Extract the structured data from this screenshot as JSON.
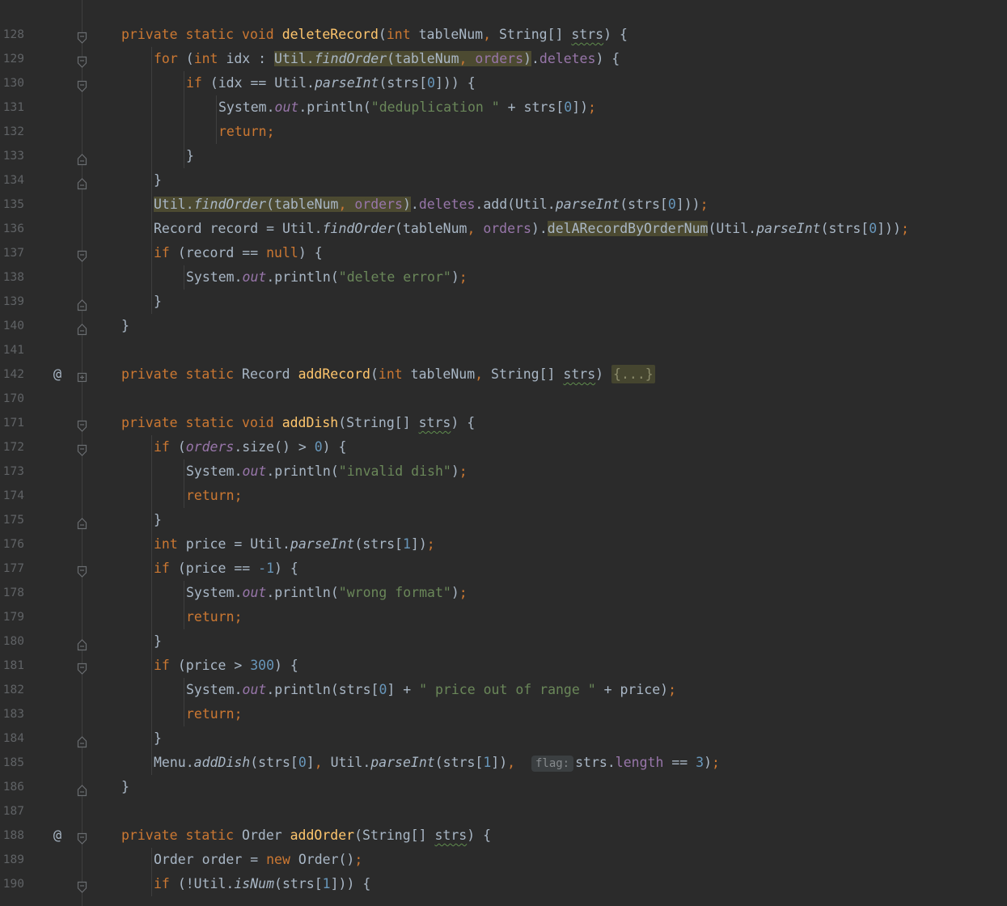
{
  "editor": {
    "lines": [
      {
        "num": "128",
        "mark": "",
        "fold": "open",
        "indent": 1,
        "tokens": [
          [
            "k",
            "private static void "
          ],
          [
            "m",
            "deleteRecord"
          ],
          [
            "p",
            "("
          ],
          [
            "k",
            "int "
          ],
          [
            "p",
            "tableNum"
          ],
          [
            "k",
            ", "
          ],
          [
            "p",
            "String[] "
          ],
          [
            "pw",
            "strs"
          ],
          [
            "p",
            ") {"
          ]
        ]
      },
      {
        "num": "129",
        "mark": "",
        "fold": "open",
        "indent": 2,
        "tokens": [
          [
            "k",
            "for "
          ],
          [
            "p",
            "("
          ],
          [
            "k",
            "int "
          ],
          [
            "p",
            "idx : "
          ],
          [
            "hp",
            "Util."
          ],
          [
            "hi",
            "findOrder"
          ],
          [
            "hp",
            "(tableNum"
          ],
          [
            "hk",
            ", "
          ],
          [
            "hf",
            "orders"
          ],
          [
            "hp",
            ")"
          ],
          [
            "p",
            "."
          ],
          [
            "f",
            "deletes"
          ],
          [
            "p",
            ") {"
          ]
        ]
      },
      {
        "num": "130",
        "mark": "",
        "fold": "open",
        "indent": 3,
        "tokens": [
          [
            "k",
            "if "
          ],
          [
            "p",
            "(idx == Util."
          ],
          [
            "i",
            "parseInt"
          ],
          [
            "p",
            "(strs["
          ],
          [
            "n",
            "0"
          ],
          [
            "p",
            "])) {"
          ]
        ]
      },
      {
        "num": "131",
        "mark": "",
        "fold": "",
        "indent": 4,
        "tokens": [
          [
            "p",
            "System."
          ],
          [
            "fi",
            "out"
          ],
          [
            "p",
            ".println("
          ],
          [
            "s",
            "\"deduplication \""
          ],
          [
            "p",
            " + strs["
          ],
          [
            "n",
            "0"
          ],
          [
            "p",
            "])"
          ],
          [
            "k",
            ";"
          ]
        ]
      },
      {
        "num": "132",
        "mark": "",
        "fold": "",
        "indent": 4,
        "tokens": [
          [
            "k",
            "return;"
          ]
        ]
      },
      {
        "num": "133",
        "mark": "",
        "fold": "close",
        "indent": 3,
        "tokens": [
          [
            "p",
            "}"
          ]
        ]
      },
      {
        "num": "134",
        "mark": "",
        "fold": "close",
        "indent": 2,
        "tokens": [
          [
            "p",
            "}"
          ]
        ]
      },
      {
        "num": "135",
        "mark": "",
        "fold": "",
        "indent": 2,
        "tokens": [
          [
            "hp",
            "Util."
          ],
          [
            "hi",
            "findOrder"
          ],
          [
            "hp",
            "(tableNum"
          ],
          [
            "hk",
            ", "
          ],
          [
            "hf",
            "orders"
          ],
          [
            "hp",
            ")"
          ],
          [
            "p",
            "."
          ],
          [
            "f",
            "deletes"
          ],
          [
            "p",
            ".add(Util."
          ],
          [
            "i",
            "parseInt"
          ],
          [
            "p",
            "(strs["
          ],
          [
            "n",
            "0"
          ],
          [
            "p",
            "]))"
          ],
          [
            "k",
            ";"
          ]
        ]
      },
      {
        "num": "136",
        "mark": "",
        "fold": "",
        "indent": 2,
        "tokens": [
          [
            "p",
            "Record record = Util."
          ],
          [
            "i",
            "findOrder"
          ],
          [
            "p",
            "(tableNum"
          ],
          [
            "k",
            ", "
          ],
          [
            "f",
            "orders"
          ],
          [
            "p",
            ")."
          ],
          [
            "hp",
            "delARecordByOrderNum"
          ],
          [
            "p",
            "(Util."
          ],
          [
            "i",
            "parseInt"
          ],
          [
            "p",
            "(strs["
          ],
          [
            "n",
            "0"
          ],
          [
            "p",
            "]))"
          ],
          [
            "k",
            ";"
          ]
        ]
      },
      {
        "num": "137",
        "mark": "",
        "fold": "open",
        "indent": 2,
        "tokens": [
          [
            "k",
            "if "
          ],
          [
            "p",
            "(record == "
          ],
          [
            "k",
            "null"
          ],
          [
            "p",
            ") {"
          ]
        ]
      },
      {
        "num": "138",
        "mark": "",
        "fold": "",
        "indent": 3,
        "tokens": [
          [
            "p",
            "System."
          ],
          [
            "fi",
            "out"
          ],
          [
            "p",
            ".println("
          ],
          [
            "s",
            "\"delete error\""
          ],
          [
            "p",
            ")"
          ],
          [
            "k",
            ";"
          ]
        ]
      },
      {
        "num": "139",
        "mark": "",
        "fold": "close",
        "indent": 2,
        "tokens": [
          [
            "p",
            "}"
          ]
        ]
      },
      {
        "num": "140",
        "mark": "",
        "fold": "close",
        "indent": 1,
        "tokens": [
          [
            "p",
            "}"
          ]
        ]
      },
      {
        "num": "141",
        "mark": "",
        "fold": "",
        "indent": 1,
        "tokens": []
      },
      {
        "num": "142",
        "mark": "@",
        "fold": "folded",
        "indent": 1,
        "tokens": [
          [
            "k",
            "private static "
          ],
          [
            "p",
            "Record "
          ],
          [
            "m",
            "addRecord"
          ],
          [
            "p",
            "("
          ],
          [
            "k",
            "int "
          ],
          [
            "p",
            "tableNum"
          ],
          [
            "k",
            ", "
          ],
          [
            "p",
            "String[] "
          ],
          [
            "pw",
            "strs"
          ],
          [
            "p",
            ") "
          ],
          [
            "fd",
            "{...}"
          ]
        ]
      },
      {
        "num": "170",
        "mark": "",
        "fold": "",
        "indent": 1,
        "tokens": []
      },
      {
        "num": "171",
        "mark": "",
        "fold": "open",
        "indent": 1,
        "tokens": [
          [
            "k",
            "private static void "
          ],
          [
            "m",
            "addDish"
          ],
          [
            "p",
            "(String[] "
          ],
          [
            "pw",
            "strs"
          ],
          [
            "p",
            ") {"
          ]
        ]
      },
      {
        "num": "172",
        "mark": "",
        "fold": "open",
        "indent": 2,
        "tokens": [
          [
            "k",
            "if "
          ],
          [
            "p",
            "("
          ],
          [
            "fi",
            "orders"
          ],
          [
            "p",
            ".size() > "
          ],
          [
            "n",
            "0"
          ],
          [
            "p",
            ") {"
          ]
        ]
      },
      {
        "num": "173",
        "mark": "",
        "fold": "",
        "indent": 3,
        "tokens": [
          [
            "p",
            "System."
          ],
          [
            "fi",
            "out"
          ],
          [
            "p",
            ".println("
          ],
          [
            "s",
            "\"invalid dish\""
          ],
          [
            "p",
            ")"
          ],
          [
            "k",
            ";"
          ]
        ]
      },
      {
        "num": "174",
        "mark": "",
        "fold": "",
        "indent": 3,
        "tokens": [
          [
            "k",
            "return;"
          ]
        ]
      },
      {
        "num": "175",
        "mark": "",
        "fold": "close",
        "indent": 2,
        "tokens": [
          [
            "p",
            "}"
          ]
        ]
      },
      {
        "num": "176",
        "mark": "",
        "fold": "",
        "indent": 2,
        "tokens": [
          [
            "k",
            "int "
          ],
          [
            "p",
            "price = Util."
          ],
          [
            "i",
            "parseInt"
          ],
          [
            "p",
            "(strs["
          ],
          [
            "n",
            "1"
          ],
          [
            "p",
            "])"
          ],
          [
            "k",
            ";"
          ]
        ]
      },
      {
        "num": "177",
        "mark": "",
        "fold": "open",
        "indent": 2,
        "tokens": [
          [
            "k",
            "if "
          ],
          [
            "p",
            "(price == "
          ],
          [
            "n",
            "-1"
          ],
          [
            "p",
            ") {"
          ]
        ]
      },
      {
        "num": "178",
        "mark": "",
        "fold": "",
        "indent": 3,
        "tokens": [
          [
            "p",
            "System."
          ],
          [
            "fi",
            "out"
          ],
          [
            "p",
            ".println("
          ],
          [
            "s",
            "\"wrong format\""
          ],
          [
            "p",
            ")"
          ],
          [
            "k",
            ";"
          ]
        ]
      },
      {
        "num": "179",
        "mark": "",
        "fold": "",
        "indent": 3,
        "tokens": [
          [
            "k",
            "return;"
          ]
        ]
      },
      {
        "num": "180",
        "mark": "",
        "fold": "close",
        "indent": 2,
        "tokens": [
          [
            "p",
            "}"
          ]
        ]
      },
      {
        "num": "181",
        "mark": "",
        "fold": "open",
        "indent": 2,
        "tokens": [
          [
            "k",
            "if "
          ],
          [
            "p",
            "(price > "
          ],
          [
            "n",
            "300"
          ],
          [
            "p",
            ") {"
          ]
        ]
      },
      {
        "num": "182",
        "mark": "",
        "fold": "",
        "indent": 3,
        "tokens": [
          [
            "p",
            "System."
          ],
          [
            "fi",
            "out"
          ],
          [
            "p",
            ".println(strs["
          ],
          [
            "n",
            "0"
          ],
          [
            "p",
            "] + "
          ],
          [
            "s",
            "\" price out of range \""
          ],
          [
            "p",
            " + price)"
          ],
          [
            "k",
            ";"
          ]
        ]
      },
      {
        "num": "183",
        "mark": "",
        "fold": "",
        "indent": 3,
        "tokens": [
          [
            "k",
            "return;"
          ]
        ]
      },
      {
        "num": "184",
        "mark": "",
        "fold": "close",
        "indent": 2,
        "tokens": [
          [
            "p",
            "}"
          ]
        ]
      },
      {
        "num": "185",
        "mark": "",
        "fold": "",
        "indent": 2,
        "tokens": [
          [
            "p",
            "Menu."
          ],
          [
            "i",
            "addDish"
          ],
          [
            "p",
            "(strs["
          ],
          [
            "n",
            "0"
          ],
          [
            "p",
            "]"
          ],
          [
            "k",
            ", "
          ],
          [
            "p",
            "Util."
          ],
          [
            "i",
            "parseInt"
          ],
          [
            "p",
            "(strs["
          ],
          [
            "n",
            "1"
          ],
          [
            "p",
            "])"
          ],
          [
            "k",
            ",  "
          ],
          [
            "hint",
            "flag:"
          ],
          [
            "p",
            "strs."
          ],
          [
            "f",
            "length"
          ],
          [
            "p",
            " == "
          ],
          [
            "n",
            "3"
          ],
          [
            "p",
            ")"
          ],
          [
            "k",
            ";"
          ]
        ]
      },
      {
        "num": "186",
        "mark": "",
        "fold": "close",
        "indent": 1,
        "tokens": [
          [
            "p",
            "}"
          ]
        ]
      },
      {
        "num": "187",
        "mark": "",
        "fold": "",
        "indent": 1,
        "tokens": []
      },
      {
        "num": "188",
        "mark": "@",
        "fold": "open",
        "indent": 1,
        "tokens": [
          [
            "k",
            "private static "
          ],
          [
            "p",
            "Order "
          ],
          [
            "m",
            "addOrder"
          ],
          [
            "p",
            "(String[] "
          ],
          [
            "pw",
            "strs"
          ],
          [
            "p",
            ") {"
          ]
        ]
      },
      {
        "num": "189",
        "mark": "",
        "fold": "",
        "indent": 2,
        "tokens": [
          [
            "p",
            "Order order = "
          ],
          [
            "k",
            "new "
          ],
          [
            "p",
            "Order()"
          ],
          [
            "k",
            ";"
          ]
        ]
      },
      {
        "num": "190",
        "mark": "",
        "fold": "open",
        "indent": 2,
        "tokens": [
          [
            "k",
            "if "
          ],
          [
            "p",
            "(!Util."
          ],
          [
            "i",
            "isNum"
          ],
          [
            "p",
            "(strs["
          ],
          [
            "n",
            "1"
          ],
          [
            "p",
            "])) {"
          ]
        ]
      }
    ]
  }
}
